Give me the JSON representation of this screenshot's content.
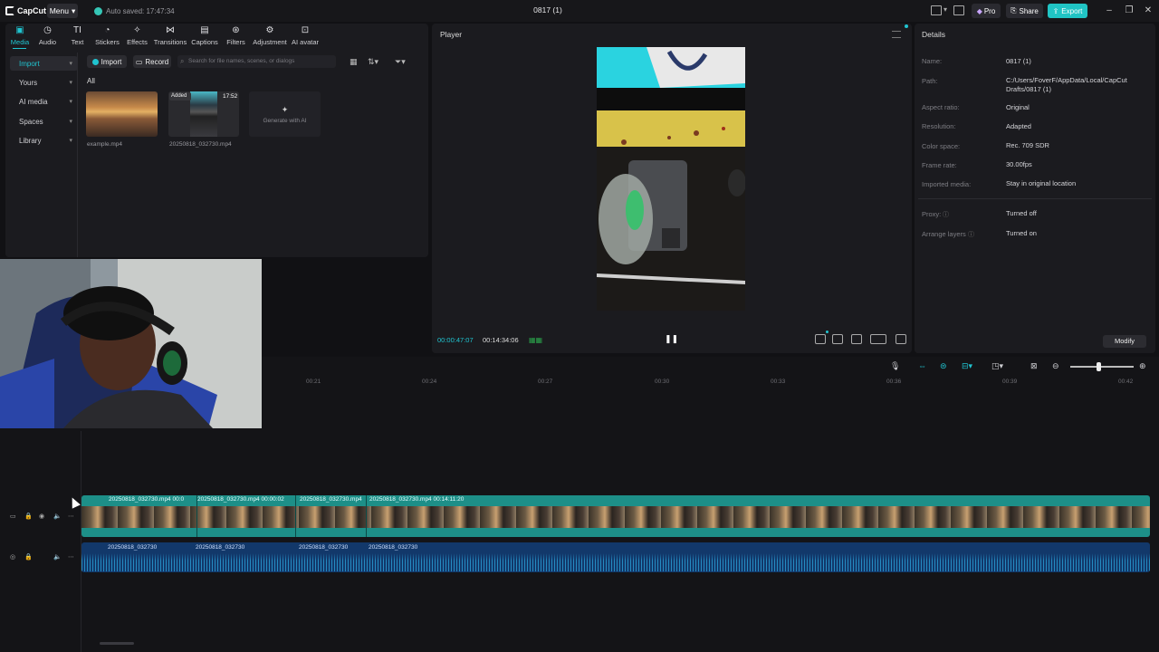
{
  "titlebar": {
    "app_name": "CapCut",
    "menu_label": "Menu",
    "autosave_text": "Auto saved: 17:47:34",
    "project_title": "0817 (1)",
    "pro_label": "Pro",
    "share_label": "Share",
    "export_label": "Export"
  },
  "toolbar": {
    "tabs": [
      {
        "label": "Media",
        "icon": "media-icon"
      },
      {
        "label": "Audio",
        "icon": "audio-icon"
      },
      {
        "label": "Text",
        "icon": "text-icon"
      },
      {
        "label": "Stickers",
        "icon": "stickers-icon"
      },
      {
        "label": "Effects",
        "icon": "effects-icon"
      },
      {
        "label": "Transitions",
        "icon": "transitions-icon"
      },
      {
        "label": "Captions",
        "icon": "captions-icon"
      },
      {
        "label": "Filters",
        "icon": "filters-icon"
      },
      {
        "label": "Adjustment",
        "icon": "adjustment-icon"
      },
      {
        "label": "AI avatar",
        "icon": "ai-avatar-icon"
      }
    ]
  },
  "media": {
    "nav": [
      "Import",
      "Yours",
      "AI media",
      "Spaces",
      "Library"
    ],
    "import_btn": "Import",
    "record_btn": "Record",
    "search_placeholder": "Search for file names, scenes, or dialogs",
    "filter_all": "All",
    "items": [
      {
        "name": "example.mp4"
      },
      {
        "name": "20250818_032730.mp4",
        "badge": "Added",
        "duration": "17:52"
      }
    ],
    "ai_generate": "Generate with AI"
  },
  "player": {
    "title": "Player",
    "current_time": "00:00:47:07",
    "total_time": "00:14:34:06"
  },
  "details": {
    "title": "Details",
    "rows": [
      {
        "label": "Name:",
        "value": "0817 (1)"
      },
      {
        "label": "Path:",
        "value": "C:/Users/FoverF/AppData/Local/CapCut Drafts/0817 (1)"
      },
      {
        "label": "Aspect ratio:",
        "value": "Original"
      },
      {
        "label": "Resolution:",
        "value": "Adapted"
      },
      {
        "label": "Color space:",
        "value": "Rec. 709 SDR"
      },
      {
        "label": "Frame rate:",
        "value": "30.00fps"
      },
      {
        "label": "Imported media:",
        "value": "Stay in original location"
      },
      {
        "label": "Proxy:",
        "value": "Turned off"
      },
      {
        "label": "Arrange layers",
        "value": "Turned on"
      }
    ],
    "modify_label": "Modify"
  },
  "timeline": {
    "ruler_ticks": [
      "00:21",
      "00:24",
      "00:27",
      "00:30",
      "00:33",
      "00:36",
      "00:39",
      "00:42"
    ],
    "video_clips": [
      {
        "label": "20250818_032730.mp4  00:0"
      },
      {
        "label": "20250818_032730.mp4  00:00:02"
      },
      {
        "label": "20250818_032730.mp4"
      },
      {
        "label": "20250818_032730.mp4  00:14:11:20"
      }
    ],
    "audio_clips": [
      {
        "label": "20250818_032730"
      },
      {
        "label": "20250818_032730"
      },
      {
        "label": "20250818_032730"
      },
      {
        "label": "20250818_032730"
      }
    ]
  },
  "colors": {
    "accent": "#20c4d0",
    "video_track": "#1d8f88",
    "audio_track": "#12386a"
  }
}
